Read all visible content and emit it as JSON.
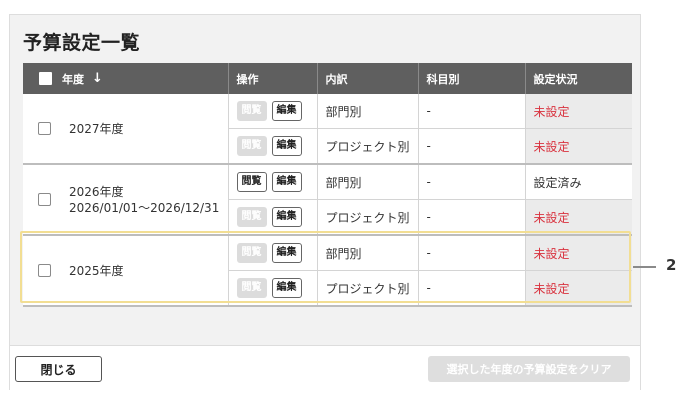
{
  "title": "予算設定一覧",
  "table": {
    "headers": {
      "year": "年度",
      "sort_icon": "↓",
      "ops": "操作",
      "breakdown": "内訳",
      "subject": "科目別",
      "status": "設定状況"
    },
    "view_label": "閲覧",
    "edit_label": "編集",
    "groups": [
      {
        "year": "2027年度",
        "period": "",
        "rows": [
          {
            "breakdown": "部門別",
            "subject": "-",
            "status": "未設定",
            "view_enabled": false
          },
          {
            "breakdown": "プロジェクト別",
            "subject": "-",
            "status": "未設定",
            "view_enabled": false
          }
        ]
      },
      {
        "year": "2026年度",
        "period": "2026/01/01～2026/12/31",
        "rows": [
          {
            "breakdown": "部門別",
            "subject": "-",
            "status": "設定済み",
            "view_enabled": true
          },
          {
            "breakdown": "プロジェクト別",
            "subject": "-",
            "status": "未設定",
            "view_enabled": false
          }
        ]
      },
      {
        "year": "2025年度",
        "period": "",
        "rows": [
          {
            "breakdown": "部門別",
            "subject": "-",
            "status": "未設定",
            "view_enabled": false
          },
          {
            "breakdown": "プロジェクト別",
            "subject": "-",
            "status": "未設定",
            "view_enabled": false
          }
        ]
      }
    ]
  },
  "footer": {
    "close_label": "閉じる",
    "clear_label": "選択した年度の予算設定をクリア"
  },
  "callout": {
    "number": "2"
  },
  "colors": {
    "header_bg": "#5f5f5f",
    "unset_status": "#d9333f",
    "highlight_border": "#f2de93"
  }
}
